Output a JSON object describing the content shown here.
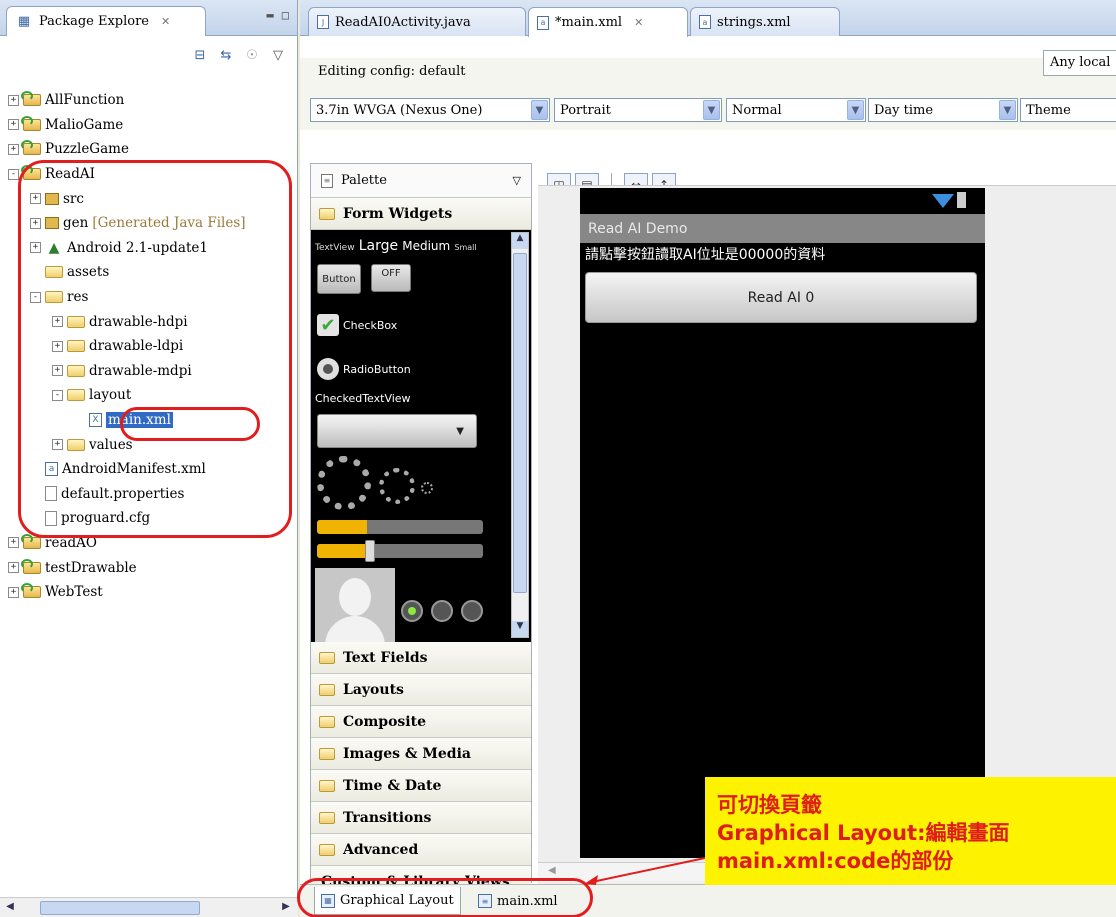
{
  "package_explorer": {
    "tab_title": "Package Explore",
    "toolbar_icons": [
      "collapse-all-icon",
      "link-editor-icon",
      "focus-icon",
      "view-menu-icon"
    ],
    "tree": [
      {
        "indent": 0,
        "expander": "+",
        "icon": "project",
        "label": "AllFunction"
      },
      {
        "indent": 0,
        "expander": "+",
        "icon": "project",
        "label": "MalioGame"
      },
      {
        "indent": 0,
        "expander": "+",
        "icon": "project",
        "label": "PuzzleGame"
      },
      {
        "indent": 0,
        "expander": "-",
        "icon": "project",
        "label": "ReadAI"
      },
      {
        "indent": 1,
        "expander": "+",
        "icon": "package",
        "label": "src"
      },
      {
        "indent": 1,
        "expander": "+",
        "icon": "package",
        "label": "gen",
        "suffix": "[Generated Java Files]"
      },
      {
        "indent": 1,
        "expander": "+",
        "icon": "android",
        "label": "Android 2.1-update1"
      },
      {
        "indent": 1,
        "expander": "",
        "icon": "folder",
        "label": "assets"
      },
      {
        "indent": 1,
        "expander": "-",
        "icon": "folder",
        "label": "res"
      },
      {
        "indent": 2,
        "expander": "+",
        "icon": "folder",
        "label": "drawable-hdpi"
      },
      {
        "indent": 2,
        "expander": "+",
        "icon": "folder",
        "label": "drawable-ldpi"
      },
      {
        "indent": 2,
        "expander": "+",
        "icon": "folder",
        "label": "drawable-mdpi"
      },
      {
        "indent": 2,
        "expander": "-",
        "icon": "folder",
        "label": "layout"
      },
      {
        "indent": 3,
        "expander": "",
        "icon": "xml",
        "label": "main.xml",
        "selected": true
      },
      {
        "indent": 2,
        "expander": "+",
        "icon": "folder",
        "label": "values"
      },
      {
        "indent": 1,
        "expander": "",
        "icon": "xml",
        "label": "AndroidManifest.xml"
      },
      {
        "indent": 1,
        "expander": "",
        "icon": "file",
        "label": "default.properties"
      },
      {
        "indent": 1,
        "expander": "",
        "icon": "file",
        "label": "proguard.cfg"
      },
      {
        "indent": 0,
        "expander": "+",
        "icon": "project",
        "label": "readAO"
      },
      {
        "indent": 0,
        "expander": "+",
        "icon": "project",
        "label": "testDrawable"
      },
      {
        "indent": 0,
        "expander": "+",
        "icon": "project",
        "label": "WebTest"
      }
    ]
  },
  "editor_tabs": [
    {
      "label": "ReadAI0Activity.java",
      "icon": "J",
      "active": false
    },
    {
      "label": "*main.xml",
      "icon": "a",
      "active": true
    },
    {
      "label": "strings.xml",
      "icon": "a",
      "active": false
    }
  ],
  "config": {
    "editing_label": "Editing config: default",
    "locale": "Any local",
    "device": "3.7in WVGA (Nexus One)",
    "orientation": "Portrait",
    "density": "Normal",
    "time": "Day time",
    "theme": "Theme"
  },
  "palette": {
    "title": "Palette",
    "open_drawer": "Form Widgets",
    "widgets": {
      "textview_small_label": "TextView",
      "large": "Large",
      "medium": "Medium",
      "small": "Small",
      "button": "Button",
      "toggle": "OFF",
      "checkbox": "CheckBox",
      "radiobutton": "RadioButton",
      "checkedtextview": "CheckedTextView"
    },
    "drawers": [
      "Text Fields",
      "Layouts",
      "Composite",
      "Images & Media",
      "Time & Date",
      "Transitions",
      "Advanced"
    ],
    "custom": "Custom & Library Views"
  },
  "device": {
    "app_title": "Read AI Demo",
    "message": "請點擊按鈕讀取AI位址是00000的資料",
    "button": "Read AI 0"
  },
  "bottom_tabs": [
    {
      "label": "Graphical Layout",
      "active": true
    },
    {
      "label": "main.xml",
      "active": false
    }
  ],
  "annotation": {
    "line1": "可切換頁籤",
    "line2": "Graphical Layout:編輯畫面",
    "line3": "main.xml:code的部份",
    "color_text": "#e01d1d",
    "color_bg": "#fdf200"
  }
}
